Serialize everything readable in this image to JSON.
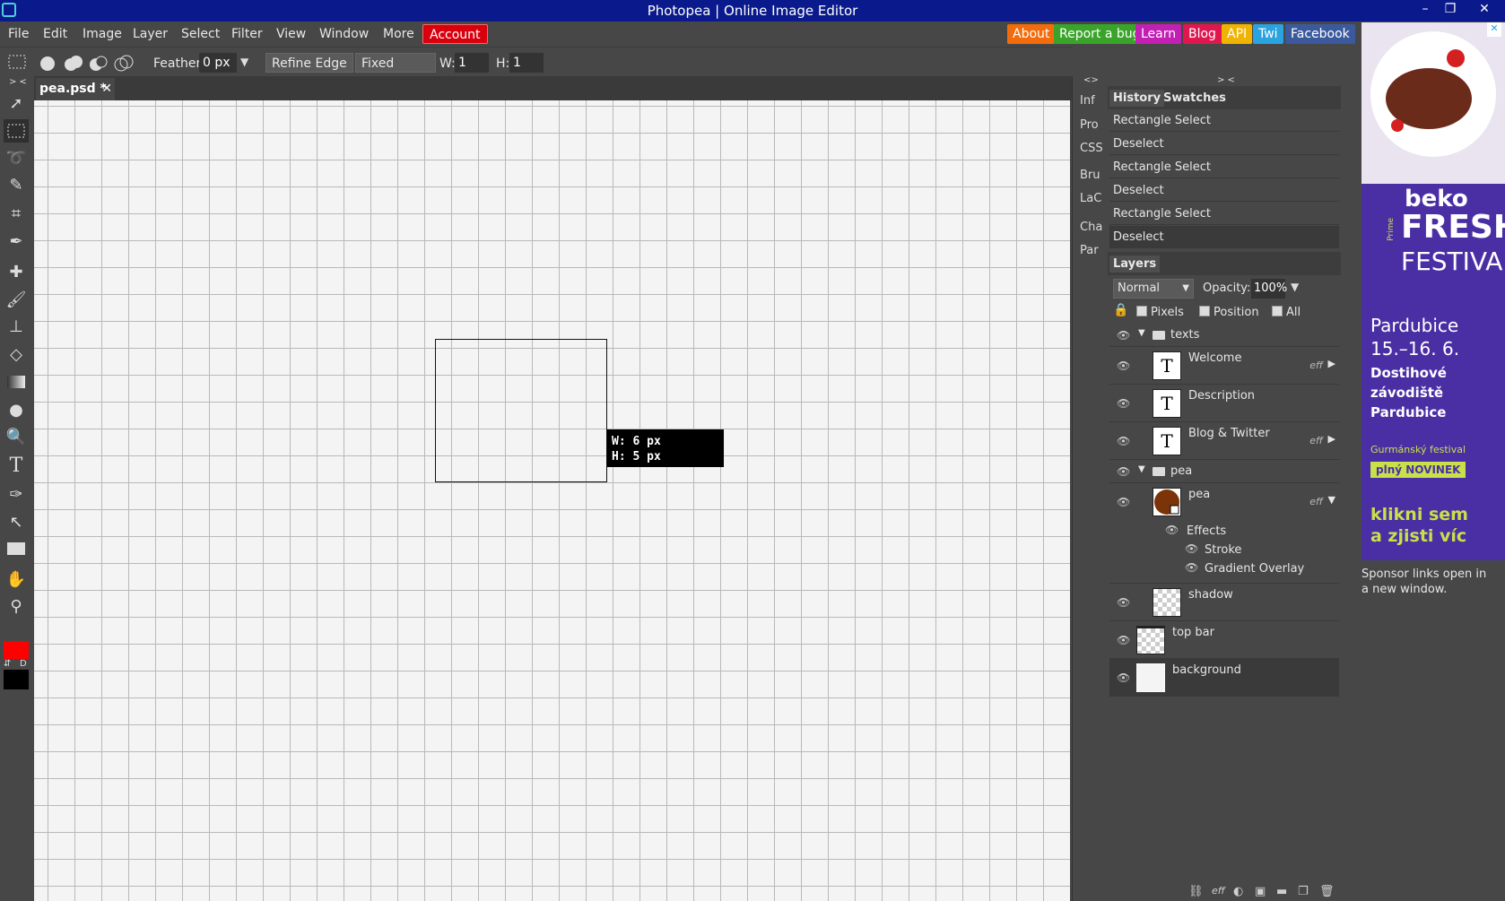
{
  "window": {
    "title": "Photopea | Online Image Editor",
    "minimize": "–",
    "restore": "❐",
    "close": "✕"
  },
  "menu": [
    "File",
    "Edit",
    "Image",
    "Layer",
    "Select",
    "Filter",
    "View",
    "Window",
    "More"
  ],
  "account_label": "Account",
  "top_links": [
    {
      "label": "About",
      "color": "#f26c0d"
    },
    {
      "label": "Report a bug",
      "color": "#3aa32a"
    },
    {
      "label": "Learn",
      "color": "#c41fb5"
    },
    {
      "label": "Blog",
      "color": "#e0174f"
    },
    {
      "label": "API",
      "color": "#f0b400"
    },
    {
      "label": "Twi",
      "color": "#2aa3e0"
    },
    {
      "label": "Facebook",
      "color": "#3b5a9d"
    }
  ],
  "options": {
    "feather_label": "Feather:",
    "feather_value": "0",
    "feather_unit": "px",
    "refine_edge": "Refine Edge",
    "style_select": "Fixed Ratio",
    "w_label": "W:",
    "w_value": "1",
    "h_label": "H:",
    "h_value": "1"
  },
  "toolbar": {
    "collapse": "> <",
    "icons": [
      "move-tool-icon",
      "rect-select-icon",
      "lasso-icon",
      "quick-select-icon",
      "crop-icon",
      "eyedropper-icon",
      "healing-icon",
      "brush-icon",
      "stamp-icon",
      "eraser-icon",
      "gradient-icon",
      "blur-icon",
      "dodge-icon",
      "type-icon",
      "pen-icon",
      "path-select-icon",
      "shape-icon",
      "hand-icon",
      "zoom-icon"
    ],
    "foreground_color": "#ff0000",
    "background_color": "#000000",
    "swap_label": "⇵",
    "default_label": "D"
  },
  "document_tab": {
    "name": "pea.psd *",
    "close": "✕"
  },
  "selection_tooltip": {
    "w": "W: 6 px",
    "h": "H: 5 px"
  },
  "side_strip": {
    "toggle": "<>",
    "items": [
      "Inf",
      "Pro",
      "CSS",
      "Bru",
      "LaC",
      "Cha",
      "Par"
    ]
  },
  "panels_toggle": "> <",
  "history": {
    "tabs": [
      "History",
      "Swatches"
    ],
    "items": [
      "Rectangle Select",
      "Deselect",
      "Rectangle Select",
      "Deselect",
      "Rectangle Select",
      "Deselect"
    ]
  },
  "layers": {
    "tab": "Layers",
    "blend_mode": "Normal",
    "opacity_label": "Opacity:",
    "opacity_value": "100%",
    "lock_labels": [
      "Pixels",
      "Position",
      "All"
    ],
    "items": [
      {
        "name": "texts",
        "type": "folder"
      },
      {
        "name": "Welcome",
        "type": "text",
        "eff": "eff"
      },
      {
        "name": "Description",
        "type": "text"
      },
      {
        "name": "Blog & Twitter",
        "type": "text",
        "eff": "eff"
      },
      {
        "name": "pea",
        "type": "folder"
      },
      {
        "name": "pea",
        "type": "image",
        "eff": "eff"
      },
      {
        "name": "Effects",
        "type": "effects"
      },
      {
        "name": "Stroke",
        "type": "effect"
      },
      {
        "name": "Gradient Overlay",
        "type": "effect"
      },
      {
        "name": "shadow",
        "type": "image"
      },
      {
        "name": "top bar",
        "type": "image"
      },
      {
        "name": "background",
        "type": "image"
      }
    ],
    "text_thumb": "T",
    "eff_label": "eff"
  },
  "ad": {
    "brand": "beko",
    "headline_1": "FRESH",
    "headline_2": "FESTIVAL",
    "vertical": "Prime",
    "city": "Pardubice",
    "dates": "15.–16. 6.",
    "venue_1": "Dostihové",
    "venue_2": "závodiště",
    "venue_3": "Pardubice",
    "tagline": "Gurmánský festival",
    "badge": "plný NOVINEK",
    "cta_1": "klikni sem",
    "cta_2": "a zjisti víc",
    "sponsor_note": "Sponsor links open in a new window."
  },
  "bottom_icons": [
    "link-icon",
    "eff-icon",
    "adjustment-icon",
    "mask-icon",
    "folder-icon",
    "new-layer-icon",
    "trash-icon"
  ]
}
